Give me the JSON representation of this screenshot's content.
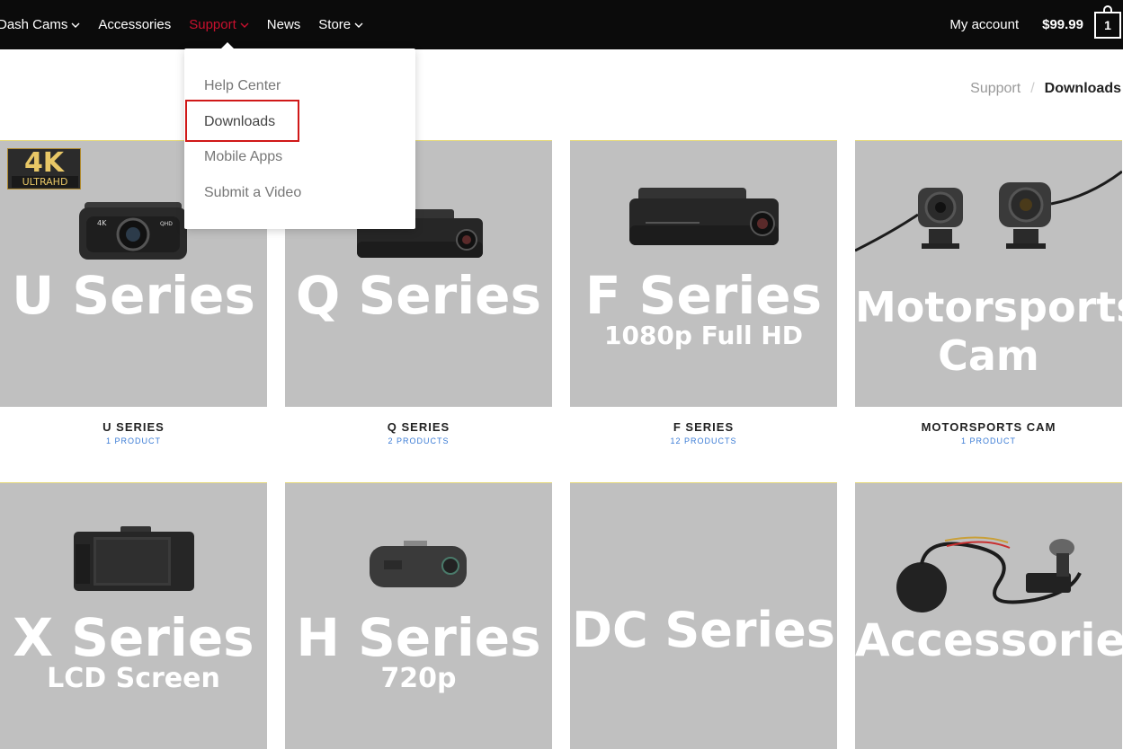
{
  "nav": {
    "items": [
      {
        "label": "Dash Cams",
        "has_menu": true
      },
      {
        "label": "Accessories",
        "has_menu": false
      },
      {
        "label": "Support",
        "has_menu": true
      },
      {
        "label": "News",
        "has_menu": false
      },
      {
        "label": "Store",
        "has_menu": true
      }
    ],
    "account_label": "My account",
    "cart_total": "$99.99",
    "cart_count": "1",
    "active_color": "#c8102e"
  },
  "dropdown": {
    "items": [
      "Help Center",
      "Downloads",
      "Mobile Apps",
      "Submit a Video"
    ],
    "highlighted": "Downloads"
  },
  "breadcrumb": {
    "parent": "Support",
    "separator": "/",
    "current": "Downloads"
  },
  "badge": {
    "main": "4K",
    "sub": "ULTRAHD"
  },
  "tiles": [
    {
      "title": "U Series",
      "subtitle": "",
      "caption": "U SERIES",
      "count": "1 PRODUCT",
      "image": "dash-cam-u-image"
    },
    {
      "title": "Q Series",
      "subtitle": "",
      "caption": "Q SERIES",
      "count": "2 PRODUCTS",
      "image": "dash-cam-q-image"
    },
    {
      "title": "F Series",
      "subtitle": "1080p Full HD",
      "caption": "F SERIES",
      "count": "12 PRODUCTS",
      "image": "dash-cam-f-image"
    },
    {
      "title": "Motorsports",
      "subtitle": "Cam",
      "caption": "MOTORSPORTS CAM",
      "count": "1 PRODUCT",
      "image": "motorsports-cam-image"
    },
    {
      "title": "X Series",
      "subtitle": "LCD Screen",
      "image": "dash-cam-x-image"
    },
    {
      "title": "H Series",
      "subtitle": "720p",
      "image": "dash-cam-h-image"
    },
    {
      "title": "DC Series",
      "subtitle": "",
      "image": ""
    },
    {
      "title": "Accessories",
      "subtitle": "",
      "image": "accessories-image"
    }
  ]
}
